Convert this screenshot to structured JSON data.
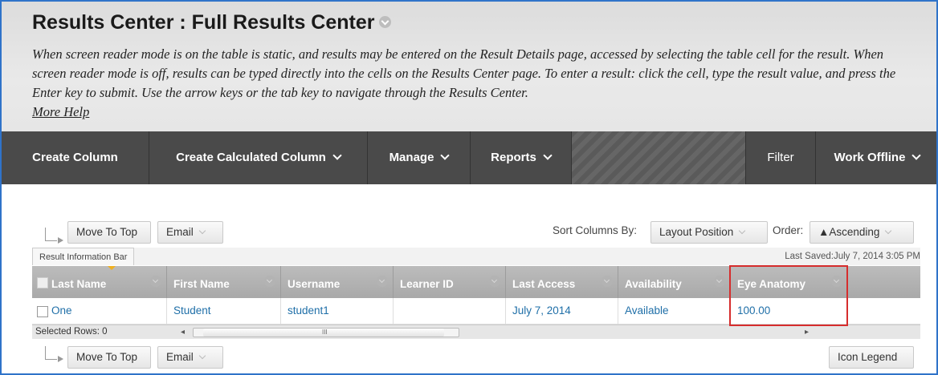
{
  "page": {
    "title": "Results Center : Full Results Center",
    "instructions": "When screen reader mode is on the table is static, and results may be entered on the Result Details page, accessed by selecting the table cell for the result. When screen reader mode is off, results can be typed directly into the cells on the Results Center page. To enter a result: click the cell, type the result value, and press the Enter key to submit. Use the arrow keys or the tab key to navigate through the Results Center.",
    "more_help": "More Help"
  },
  "actionbar": {
    "create_column": "Create Column",
    "create_calculated_column": "Create Calculated Column",
    "manage": "Manage",
    "reports": "Reports",
    "filter": "Filter",
    "work_offline": "Work Offline"
  },
  "toolbar": {
    "move_to_top": "Move To Top",
    "email": "Email",
    "sort_columns_by_label": "Sort Columns By:",
    "sort_columns_by_value": "Layout Position",
    "order_label": "Order:",
    "order_value": "▲Ascending"
  },
  "grid": {
    "info_tab": "Result Information Bar",
    "last_saved": "Last Saved:July 7, 2014 3:05 PM",
    "columns": [
      "Last Name",
      "First Name",
      "Username",
      "Learner ID",
      "Last Access",
      "Availability",
      "Eye Anatomy"
    ],
    "rows": [
      {
        "last_name": "One",
        "first_name": "Student",
        "username": "student1",
        "learner_id": "",
        "last_access": "July 7, 2014",
        "availability": "Available",
        "eye_anatomy": "100.00"
      }
    ],
    "selected_rows": "Selected Rows: 0",
    "scroll_grip": "III"
  },
  "bottom_toolbar": {
    "move_to_top": "Move To Top",
    "email": "Email",
    "icon_legend": "Icon Legend"
  },
  "colors": {
    "accent_border": "#2f73c9",
    "highlight": "#d62d2d",
    "link": "#1f6fa8",
    "actionbar": "#4a4a4a"
  }
}
